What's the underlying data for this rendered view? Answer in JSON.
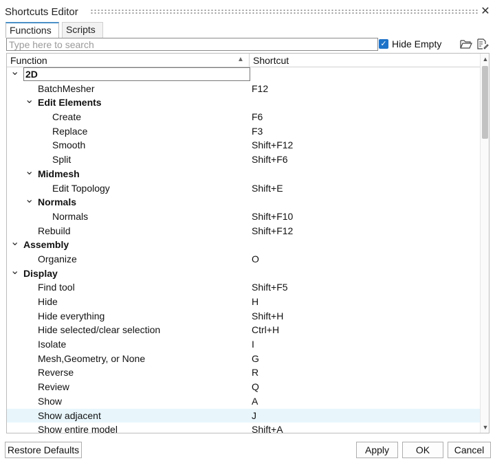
{
  "window": {
    "title": "Shortcuts Editor",
    "close_glyph": "✕"
  },
  "tabs": [
    {
      "label": "Functions",
      "active": true
    },
    {
      "label": "Scripts",
      "active": false
    }
  ],
  "search": {
    "placeholder": "Type here to search",
    "value": ""
  },
  "hide_empty": {
    "label": "Hide Empty",
    "checked": true
  },
  "toolbar_icons": [
    "open-folder-icon",
    "edit-file-icon"
  ],
  "columns": {
    "function": "Function",
    "shortcut": "Shortcut"
  },
  "rows": [
    {
      "label": "2D",
      "shortcut": "",
      "level": 0,
      "group": true,
      "expanded": true,
      "focused": true
    },
    {
      "label": "BatchMesher",
      "shortcut": "F12",
      "level": 1,
      "group": false
    },
    {
      "label": "Edit Elements",
      "shortcut": "",
      "level": 1,
      "group": true,
      "expanded": true
    },
    {
      "label": "Create",
      "shortcut": "F6",
      "level": 2,
      "group": false
    },
    {
      "label": "Replace",
      "shortcut": "F3",
      "level": 2,
      "group": false
    },
    {
      "label": "Smooth",
      "shortcut": "Shift+F12",
      "level": 2,
      "group": false
    },
    {
      "label": "Split",
      "shortcut": "Shift+F6",
      "level": 2,
      "group": false
    },
    {
      "label": "Midmesh",
      "shortcut": "",
      "level": 1,
      "group": true,
      "expanded": true
    },
    {
      "label": "Edit Topology",
      "shortcut": "Shift+E",
      "level": 2,
      "group": false
    },
    {
      "label": "Normals",
      "shortcut": "",
      "level": 1,
      "group": true,
      "expanded": true
    },
    {
      "label": "Normals",
      "shortcut": "Shift+F10",
      "level": 2,
      "group": false
    },
    {
      "label": "Rebuild",
      "shortcut": "Shift+F12",
      "level": 1,
      "group": false
    },
    {
      "label": "Assembly",
      "shortcut": "",
      "level": 0,
      "group": true,
      "expanded": true
    },
    {
      "label": "Organize",
      "shortcut": "O",
      "level": 1,
      "group": false
    },
    {
      "label": "Display",
      "shortcut": "",
      "level": 0,
      "group": true,
      "expanded": true
    },
    {
      "label": "Find tool",
      "shortcut": "Shift+F5",
      "level": 1,
      "group": false
    },
    {
      "label": "Hide",
      "shortcut": "H",
      "level": 1,
      "group": false
    },
    {
      "label": "Hide everything",
      "shortcut": "Shift+H",
      "level": 1,
      "group": false
    },
    {
      "label": "Hide selected/clear selection",
      "shortcut": "Ctrl+H",
      "level": 1,
      "group": false
    },
    {
      "label": "Isolate",
      "shortcut": "I",
      "level": 1,
      "group": false
    },
    {
      "label": "Mesh,Geometry, or None",
      "shortcut": "G",
      "level": 1,
      "group": false
    },
    {
      "label": "Reverse",
      "shortcut": "R",
      "level": 1,
      "group": false
    },
    {
      "label": "Review",
      "shortcut": "Q",
      "level": 1,
      "group": false
    },
    {
      "label": "Show",
      "shortcut": "A",
      "level": 1,
      "group": false
    },
    {
      "label": "Show adjacent",
      "shortcut": "J",
      "level": 1,
      "group": false,
      "highlighted": true
    },
    {
      "label": "Show entire model",
      "shortcut": "Shift+A",
      "level": 1,
      "group": false
    }
  ],
  "buttons": {
    "restore": "Restore Defaults",
    "apply": "Apply",
    "ok": "OK",
    "cancel": "Cancel"
  },
  "colors": {
    "accent": "#1e73c8",
    "highlight_row": "#e8f6fc",
    "annotation": "#1e73c8"
  }
}
